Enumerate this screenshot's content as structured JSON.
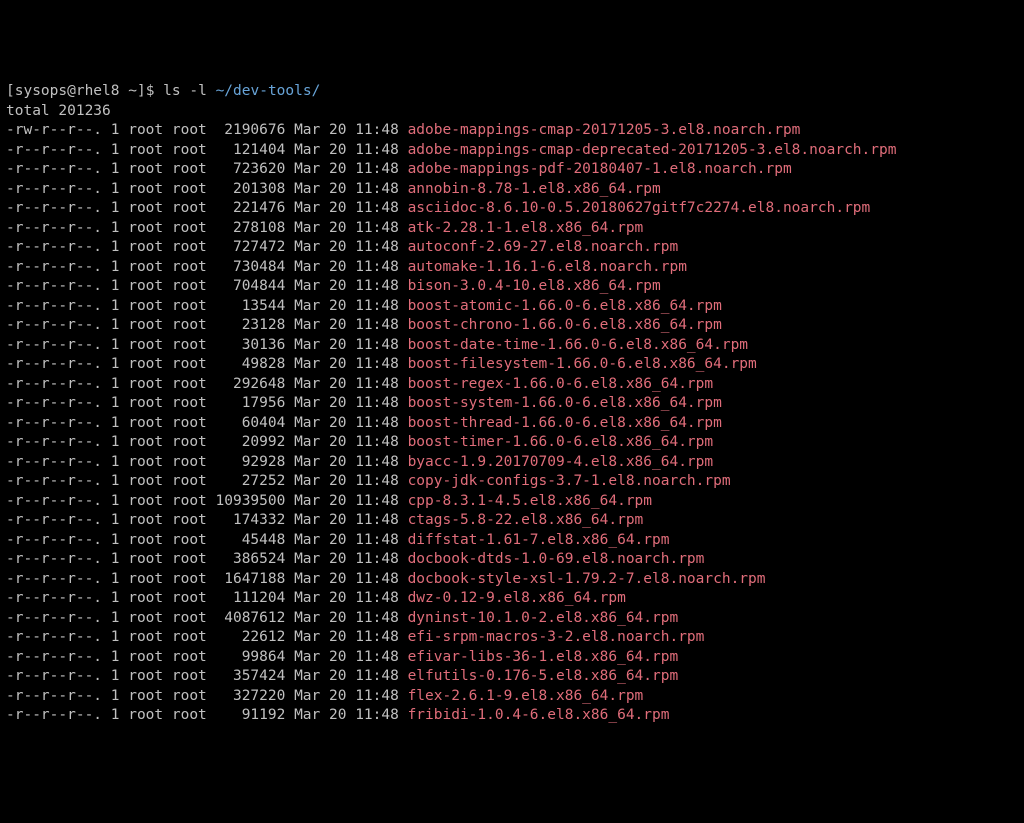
{
  "prompt": {
    "user_host": "sysops@rhel8",
    "cwd": "~",
    "symbol": "$",
    "command": "ls -l",
    "path_arg": "~/dev-tools/"
  },
  "total_line": "total 201236",
  "columns": {
    "perm": 11,
    "links": 1,
    "owner": 4,
    "group": 4,
    "date": "Mar 20 11:48"
  },
  "files": [
    {
      "perm": "-rw-r--r--.",
      "links": "1",
      "owner": "root",
      "group": "root",
      "size": "2190676",
      "date": "Mar 20 11:48",
      "name": "adobe-mappings-cmap-20171205-3.el8.noarch.rpm"
    },
    {
      "perm": "-r--r--r--.",
      "links": "1",
      "owner": "root",
      "group": "root",
      "size": "121404",
      "date": "Mar 20 11:48",
      "name": "adobe-mappings-cmap-deprecated-20171205-3.el8.noarch.rpm"
    },
    {
      "perm": "-r--r--r--.",
      "links": "1",
      "owner": "root",
      "group": "root",
      "size": "723620",
      "date": "Mar 20 11:48",
      "name": "adobe-mappings-pdf-20180407-1.el8.noarch.rpm"
    },
    {
      "perm": "-r--r--r--.",
      "links": "1",
      "owner": "root",
      "group": "root",
      "size": "201308",
      "date": "Mar 20 11:48",
      "name": "annobin-8.78-1.el8.x86_64.rpm"
    },
    {
      "perm": "-r--r--r--.",
      "links": "1",
      "owner": "root",
      "group": "root",
      "size": "221476",
      "date": "Mar 20 11:48",
      "name": "asciidoc-8.6.10-0.5.20180627gitf7c2274.el8.noarch.rpm"
    },
    {
      "perm": "-r--r--r--.",
      "links": "1",
      "owner": "root",
      "group": "root",
      "size": "278108",
      "date": "Mar 20 11:48",
      "name": "atk-2.28.1-1.el8.x86_64.rpm"
    },
    {
      "perm": "-r--r--r--.",
      "links": "1",
      "owner": "root",
      "group": "root",
      "size": "727472",
      "date": "Mar 20 11:48",
      "name": "autoconf-2.69-27.el8.noarch.rpm"
    },
    {
      "perm": "-r--r--r--.",
      "links": "1",
      "owner": "root",
      "group": "root",
      "size": "730484",
      "date": "Mar 20 11:48",
      "name": "automake-1.16.1-6.el8.noarch.rpm"
    },
    {
      "perm": "-r--r--r--.",
      "links": "1",
      "owner": "root",
      "group": "root",
      "size": "704844",
      "date": "Mar 20 11:48",
      "name": "bison-3.0.4-10.el8.x86_64.rpm"
    },
    {
      "perm": "-r--r--r--.",
      "links": "1",
      "owner": "root",
      "group": "root",
      "size": "13544",
      "date": "Mar 20 11:48",
      "name": "boost-atomic-1.66.0-6.el8.x86_64.rpm"
    },
    {
      "perm": "-r--r--r--.",
      "links": "1",
      "owner": "root",
      "group": "root",
      "size": "23128",
      "date": "Mar 20 11:48",
      "name": "boost-chrono-1.66.0-6.el8.x86_64.rpm"
    },
    {
      "perm": "-r--r--r--.",
      "links": "1",
      "owner": "root",
      "group": "root",
      "size": "30136",
      "date": "Mar 20 11:48",
      "name": "boost-date-time-1.66.0-6.el8.x86_64.rpm"
    },
    {
      "perm": "-r--r--r--.",
      "links": "1",
      "owner": "root",
      "group": "root",
      "size": "49828",
      "date": "Mar 20 11:48",
      "name": "boost-filesystem-1.66.0-6.el8.x86_64.rpm"
    },
    {
      "perm": "-r--r--r--.",
      "links": "1",
      "owner": "root",
      "group": "root",
      "size": "292648",
      "date": "Mar 20 11:48",
      "name": "boost-regex-1.66.0-6.el8.x86_64.rpm"
    },
    {
      "perm": "-r--r--r--.",
      "links": "1",
      "owner": "root",
      "group": "root",
      "size": "17956",
      "date": "Mar 20 11:48",
      "name": "boost-system-1.66.0-6.el8.x86_64.rpm"
    },
    {
      "perm": "-r--r--r--.",
      "links": "1",
      "owner": "root",
      "group": "root",
      "size": "60404",
      "date": "Mar 20 11:48",
      "name": "boost-thread-1.66.0-6.el8.x86_64.rpm"
    },
    {
      "perm": "-r--r--r--.",
      "links": "1",
      "owner": "root",
      "group": "root",
      "size": "20992",
      "date": "Mar 20 11:48",
      "name": "boost-timer-1.66.0-6.el8.x86_64.rpm"
    },
    {
      "perm": "-r--r--r--.",
      "links": "1",
      "owner": "root",
      "group": "root",
      "size": "92928",
      "date": "Mar 20 11:48",
      "name": "byacc-1.9.20170709-4.el8.x86_64.rpm"
    },
    {
      "perm": "-r--r--r--.",
      "links": "1",
      "owner": "root",
      "group": "root",
      "size": "27252",
      "date": "Mar 20 11:48",
      "name": "copy-jdk-configs-3.7-1.el8.noarch.rpm"
    },
    {
      "perm": "-r--r--r--.",
      "links": "1",
      "owner": "root",
      "group": "root",
      "size": "10939500",
      "date": "Mar 20 11:48",
      "name": "cpp-8.3.1-4.5.el8.x86_64.rpm"
    },
    {
      "perm": "-r--r--r--.",
      "links": "1",
      "owner": "root",
      "group": "root",
      "size": "174332",
      "date": "Mar 20 11:48",
      "name": "ctags-5.8-22.el8.x86_64.rpm"
    },
    {
      "perm": "-r--r--r--.",
      "links": "1",
      "owner": "root",
      "group": "root",
      "size": "45448",
      "date": "Mar 20 11:48",
      "name": "diffstat-1.61-7.el8.x86_64.rpm"
    },
    {
      "perm": "-r--r--r--.",
      "links": "1",
      "owner": "root",
      "group": "root",
      "size": "386524",
      "date": "Mar 20 11:48",
      "name": "docbook-dtds-1.0-69.el8.noarch.rpm"
    },
    {
      "perm": "-r--r--r--.",
      "links": "1",
      "owner": "root",
      "group": "root",
      "size": "1647188",
      "date": "Mar 20 11:48",
      "name": "docbook-style-xsl-1.79.2-7.el8.noarch.rpm"
    },
    {
      "perm": "-r--r--r--.",
      "links": "1",
      "owner": "root",
      "group": "root",
      "size": "111204",
      "date": "Mar 20 11:48",
      "name": "dwz-0.12-9.el8.x86_64.rpm"
    },
    {
      "perm": "-r--r--r--.",
      "links": "1",
      "owner": "root",
      "group": "root",
      "size": "4087612",
      "date": "Mar 20 11:48",
      "name": "dyninst-10.1.0-2.el8.x86_64.rpm"
    },
    {
      "perm": "-r--r--r--.",
      "links": "1",
      "owner": "root",
      "group": "root",
      "size": "22612",
      "date": "Mar 20 11:48",
      "name": "efi-srpm-macros-3-2.el8.noarch.rpm"
    },
    {
      "perm": "-r--r--r--.",
      "links": "1",
      "owner": "root",
      "group": "root",
      "size": "99864",
      "date": "Mar 20 11:48",
      "name": "efivar-libs-36-1.el8.x86_64.rpm"
    },
    {
      "perm": "-r--r--r--.",
      "links": "1",
      "owner": "root",
      "group": "root",
      "size": "357424",
      "date": "Mar 20 11:48",
      "name": "elfutils-0.176-5.el8.x86_64.rpm"
    },
    {
      "perm": "-r--r--r--.",
      "links": "1",
      "owner": "root",
      "group": "root",
      "size": "327220",
      "date": "Mar 20 11:48",
      "name": "flex-2.6.1-9.el8.x86_64.rpm"
    },
    {
      "perm": "-r--r--r--.",
      "links": "1",
      "owner": "root",
      "group": "root",
      "size": "91192",
      "date": "Mar 20 11:48",
      "name": "fribidi-1.0.4-6.el8.x86_64.rpm"
    }
  ]
}
